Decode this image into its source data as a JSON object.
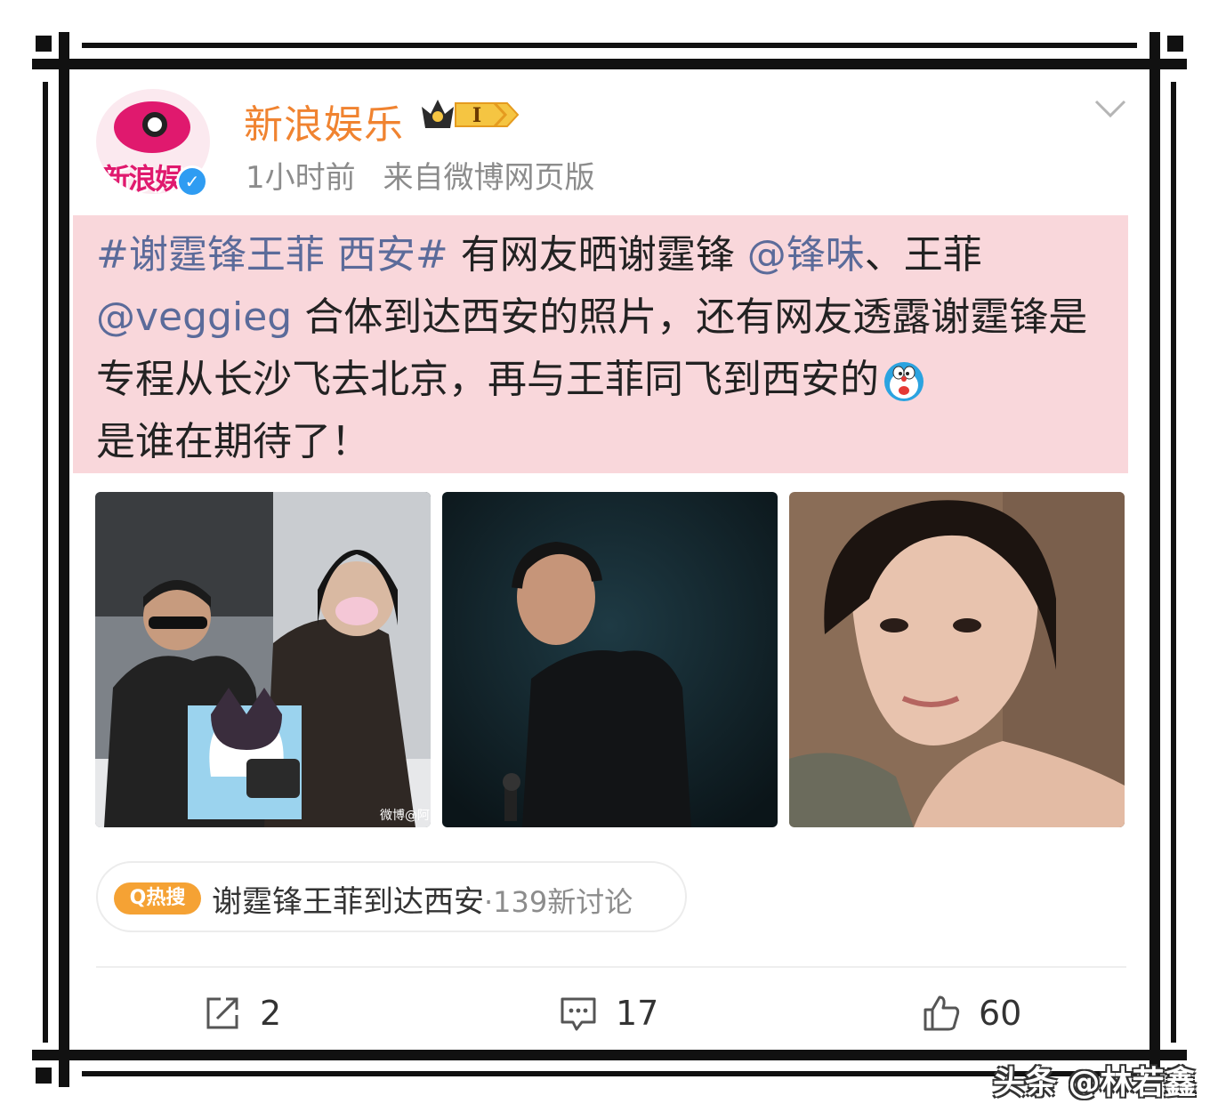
{
  "header": {
    "username": "新浪娱乐",
    "avatar_text": "新浪娱",
    "verified_mark": "✓",
    "level_badge": "I",
    "time": "1小时前",
    "source": "来自微博网页版"
  },
  "post": {
    "hashtag": "#谢霆锋王菲 西安#",
    "text_1": " 有网友晒谢霆锋",
    "mention_1": "@锋味",
    "text_2": "、王菲",
    "mention_2": "@veggieg",
    "text_3": " 合体到达西安的照片，还有网友透露谢霆锋是专程从长沙飞去北京，再与王菲同飞到西安的",
    "text_4": "是谁在期待了！"
  },
  "photos": [
    "photo-1",
    "photo-2",
    "photo-3"
  ],
  "photo1_watermark": "微博@阿",
  "hot_search": {
    "badge": "Q热搜",
    "topic": "谢霆锋王菲到达西安",
    "discussion": "·139新讨论"
  },
  "actions": {
    "repost_count": "2",
    "comment_count": "17",
    "like_count": "60"
  },
  "watermark": "头条 @林若鑫",
  "colors": {
    "username": "#f08330",
    "highlight_bg": "#f9d7db",
    "link": "#5b6b9a",
    "hot_badge": "#f5a234",
    "frame": "#111111"
  }
}
